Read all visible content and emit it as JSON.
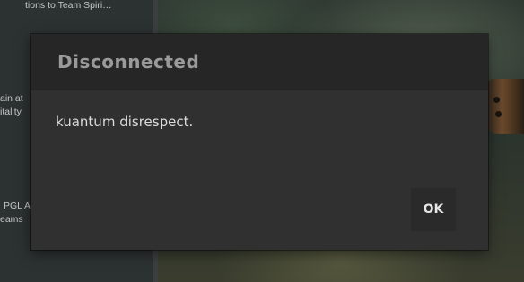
{
  "background": {
    "side_panel": {
      "line1": "tions to Team Spiri…",
      "line2": "ain at",
      "line3": "itality",
      "line4": "PGL A",
      "line5": "eams"
    }
  },
  "dialog": {
    "title": "Disconnected",
    "message": "kuantum disrespect.",
    "ok_label": "OK"
  }
}
